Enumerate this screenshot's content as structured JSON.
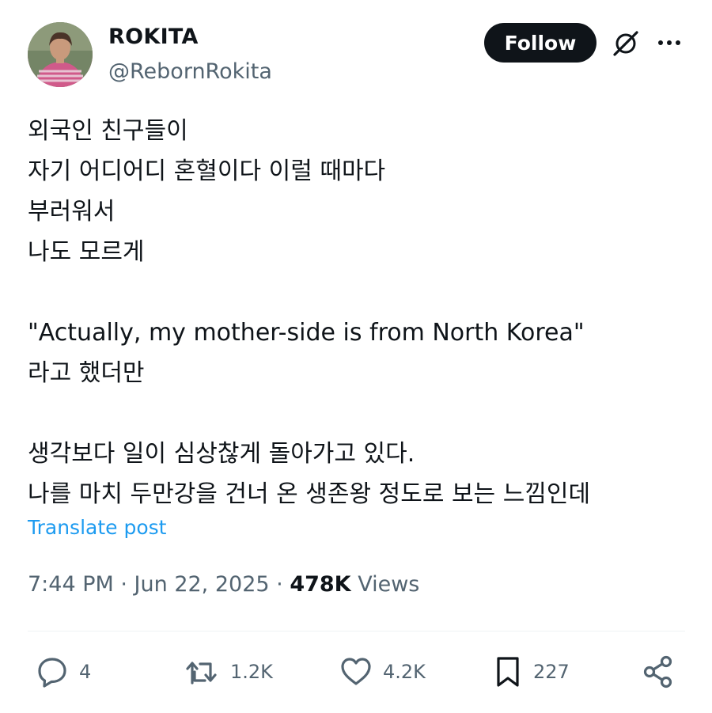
{
  "author": {
    "display_name": "ROKITA",
    "handle": "@RebornRokita",
    "avatar_icon": "profile-photo"
  },
  "header": {
    "follow_label": "Follow",
    "grok_icon": "grok-icon",
    "more_icon": "more-options-icon"
  },
  "post": {
    "lines": [
      "외국인 친구들이",
      "자기 어디어디 혼혈이다 이럴 때마다",
      "부러워서",
      "나도 모르게",
      "",
      "\"Actually, my mother-side is from North Korea\"",
      "라고 했더만",
      "",
      "생각보다 일이 심상찮게 돌아가고 있다.",
      "나를 마치 두만강을 건너 온 생존왕 정도로 보는 느낌인데"
    ],
    "translate_label": "Translate post",
    "time": "7:44 PM",
    "date": "Jun 22, 2025",
    "views_count": "478K",
    "views_label": "Views"
  },
  "actions": {
    "replies": "4",
    "reposts": "1.2K",
    "likes": "4.2K",
    "bookmarks": "227"
  },
  "colors": {
    "text": "#0f1419",
    "secondary": "#536471",
    "link": "#1d9bf0",
    "follow_bg": "#0f1419"
  }
}
